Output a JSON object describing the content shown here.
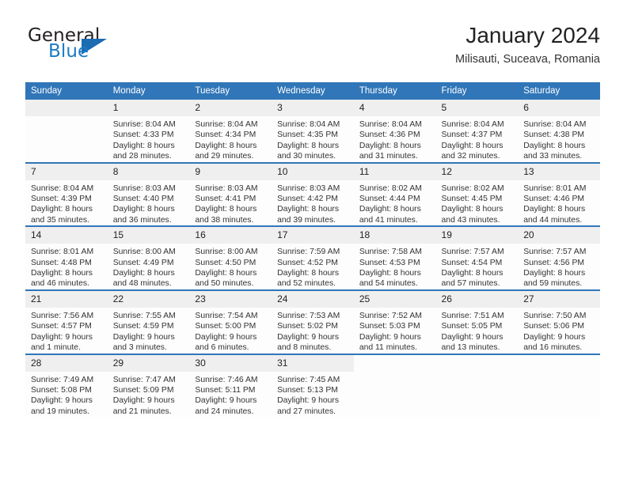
{
  "logo": {
    "word_top": "General",
    "word_bottom": "Blue",
    "triangle_color": "#1c6cb2",
    "blue_color": "#1c7bc4"
  },
  "header": {
    "title": "January 2024",
    "subtitle": "Milisauti, Suceava, Romania"
  },
  "theme": {
    "header_blue": "#3076b8",
    "date_band_gray": "#efefef",
    "text_color": "#333333"
  },
  "calendar": {
    "weekday_headers": [
      "Sunday",
      "Monday",
      "Tuesday",
      "Wednesday",
      "Thursday",
      "Friday",
      "Saturday"
    ],
    "weeks": [
      [
        {
          "day": "",
          "empty": true
        },
        {
          "day": "1",
          "sunrise": "Sunrise: 8:04 AM",
          "sunset": "Sunset: 4:33 PM",
          "daylight1": "Daylight: 8 hours",
          "daylight2": "and 28 minutes."
        },
        {
          "day": "2",
          "sunrise": "Sunrise: 8:04 AM",
          "sunset": "Sunset: 4:34 PM",
          "daylight1": "Daylight: 8 hours",
          "daylight2": "and 29 minutes."
        },
        {
          "day": "3",
          "sunrise": "Sunrise: 8:04 AM",
          "sunset": "Sunset: 4:35 PM",
          "daylight1": "Daylight: 8 hours",
          "daylight2": "and 30 minutes."
        },
        {
          "day": "4",
          "sunrise": "Sunrise: 8:04 AM",
          "sunset": "Sunset: 4:36 PM",
          "daylight1": "Daylight: 8 hours",
          "daylight2": "and 31 minutes."
        },
        {
          "day": "5",
          "sunrise": "Sunrise: 8:04 AM",
          "sunset": "Sunset: 4:37 PM",
          "daylight1": "Daylight: 8 hours",
          "daylight2": "and 32 minutes."
        },
        {
          "day": "6",
          "sunrise": "Sunrise: 8:04 AM",
          "sunset": "Sunset: 4:38 PM",
          "daylight1": "Daylight: 8 hours",
          "daylight2": "and 33 minutes."
        }
      ],
      [
        {
          "day": "7",
          "sunrise": "Sunrise: 8:04 AM",
          "sunset": "Sunset: 4:39 PM",
          "daylight1": "Daylight: 8 hours",
          "daylight2": "and 35 minutes."
        },
        {
          "day": "8",
          "sunrise": "Sunrise: 8:03 AM",
          "sunset": "Sunset: 4:40 PM",
          "daylight1": "Daylight: 8 hours",
          "daylight2": "and 36 minutes."
        },
        {
          "day": "9",
          "sunrise": "Sunrise: 8:03 AM",
          "sunset": "Sunset: 4:41 PM",
          "daylight1": "Daylight: 8 hours",
          "daylight2": "and 38 minutes."
        },
        {
          "day": "10",
          "sunrise": "Sunrise: 8:03 AM",
          "sunset": "Sunset: 4:42 PM",
          "daylight1": "Daylight: 8 hours",
          "daylight2": "and 39 minutes."
        },
        {
          "day": "11",
          "sunrise": "Sunrise: 8:02 AM",
          "sunset": "Sunset: 4:44 PM",
          "daylight1": "Daylight: 8 hours",
          "daylight2": "and 41 minutes."
        },
        {
          "day": "12",
          "sunrise": "Sunrise: 8:02 AM",
          "sunset": "Sunset: 4:45 PM",
          "daylight1": "Daylight: 8 hours",
          "daylight2": "and 43 minutes."
        },
        {
          "day": "13",
          "sunrise": "Sunrise: 8:01 AM",
          "sunset": "Sunset: 4:46 PM",
          "daylight1": "Daylight: 8 hours",
          "daylight2": "and 44 minutes."
        }
      ],
      [
        {
          "day": "14",
          "sunrise": "Sunrise: 8:01 AM",
          "sunset": "Sunset: 4:48 PM",
          "daylight1": "Daylight: 8 hours",
          "daylight2": "and 46 minutes."
        },
        {
          "day": "15",
          "sunrise": "Sunrise: 8:00 AM",
          "sunset": "Sunset: 4:49 PM",
          "daylight1": "Daylight: 8 hours",
          "daylight2": "and 48 minutes."
        },
        {
          "day": "16",
          "sunrise": "Sunrise: 8:00 AM",
          "sunset": "Sunset: 4:50 PM",
          "daylight1": "Daylight: 8 hours",
          "daylight2": "and 50 minutes."
        },
        {
          "day": "17",
          "sunrise": "Sunrise: 7:59 AM",
          "sunset": "Sunset: 4:52 PM",
          "daylight1": "Daylight: 8 hours",
          "daylight2": "and 52 minutes."
        },
        {
          "day": "18",
          "sunrise": "Sunrise: 7:58 AM",
          "sunset": "Sunset: 4:53 PM",
          "daylight1": "Daylight: 8 hours",
          "daylight2": "and 54 minutes."
        },
        {
          "day": "19",
          "sunrise": "Sunrise: 7:57 AM",
          "sunset": "Sunset: 4:54 PM",
          "daylight1": "Daylight: 8 hours",
          "daylight2": "and 57 minutes."
        },
        {
          "day": "20",
          "sunrise": "Sunrise: 7:57 AM",
          "sunset": "Sunset: 4:56 PM",
          "daylight1": "Daylight: 8 hours",
          "daylight2": "and 59 minutes."
        }
      ],
      [
        {
          "day": "21",
          "sunrise": "Sunrise: 7:56 AM",
          "sunset": "Sunset: 4:57 PM",
          "daylight1": "Daylight: 9 hours",
          "daylight2": "and 1 minute."
        },
        {
          "day": "22",
          "sunrise": "Sunrise: 7:55 AM",
          "sunset": "Sunset: 4:59 PM",
          "daylight1": "Daylight: 9 hours",
          "daylight2": "and 3 minutes."
        },
        {
          "day": "23",
          "sunrise": "Sunrise: 7:54 AM",
          "sunset": "Sunset: 5:00 PM",
          "daylight1": "Daylight: 9 hours",
          "daylight2": "and 6 minutes."
        },
        {
          "day": "24",
          "sunrise": "Sunrise: 7:53 AM",
          "sunset": "Sunset: 5:02 PM",
          "daylight1": "Daylight: 9 hours",
          "daylight2": "and 8 minutes."
        },
        {
          "day": "25",
          "sunrise": "Sunrise: 7:52 AM",
          "sunset": "Sunset: 5:03 PM",
          "daylight1": "Daylight: 9 hours",
          "daylight2": "and 11 minutes."
        },
        {
          "day": "26",
          "sunrise": "Sunrise: 7:51 AM",
          "sunset": "Sunset: 5:05 PM",
          "daylight1": "Daylight: 9 hours",
          "daylight2": "and 13 minutes."
        },
        {
          "day": "27",
          "sunrise": "Sunrise: 7:50 AM",
          "sunset": "Sunset: 5:06 PM",
          "daylight1": "Daylight: 9 hours",
          "daylight2": "and 16 minutes."
        }
      ],
      [
        {
          "day": "28",
          "sunrise": "Sunrise: 7:49 AM",
          "sunset": "Sunset: 5:08 PM",
          "daylight1": "Daylight: 9 hours",
          "daylight2": "and 19 minutes."
        },
        {
          "day": "29",
          "sunrise": "Sunrise: 7:47 AM",
          "sunset": "Sunset: 5:09 PM",
          "daylight1": "Daylight: 9 hours",
          "daylight2": "and 21 minutes."
        },
        {
          "day": "30",
          "sunrise": "Sunrise: 7:46 AM",
          "sunset": "Sunset: 5:11 PM",
          "daylight1": "Daylight: 9 hours",
          "daylight2": "and 24 minutes."
        },
        {
          "day": "31",
          "sunrise": "Sunrise: 7:45 AM",
          "sunset": "Sunset: 5:13 PM",
          "daylight1": "Daylight: 9 hours",
          "daylight2": "and 27 minutes."
        },
        {
          "day": "",
          "empty": true,
          "blank": true
        },
        {
          "day": "",
          "empty": true,
          "blank": true
        },
        {
          "day": "",
          "empty": true,
          "blank": true
        }
      ]
    ]
  }
}
